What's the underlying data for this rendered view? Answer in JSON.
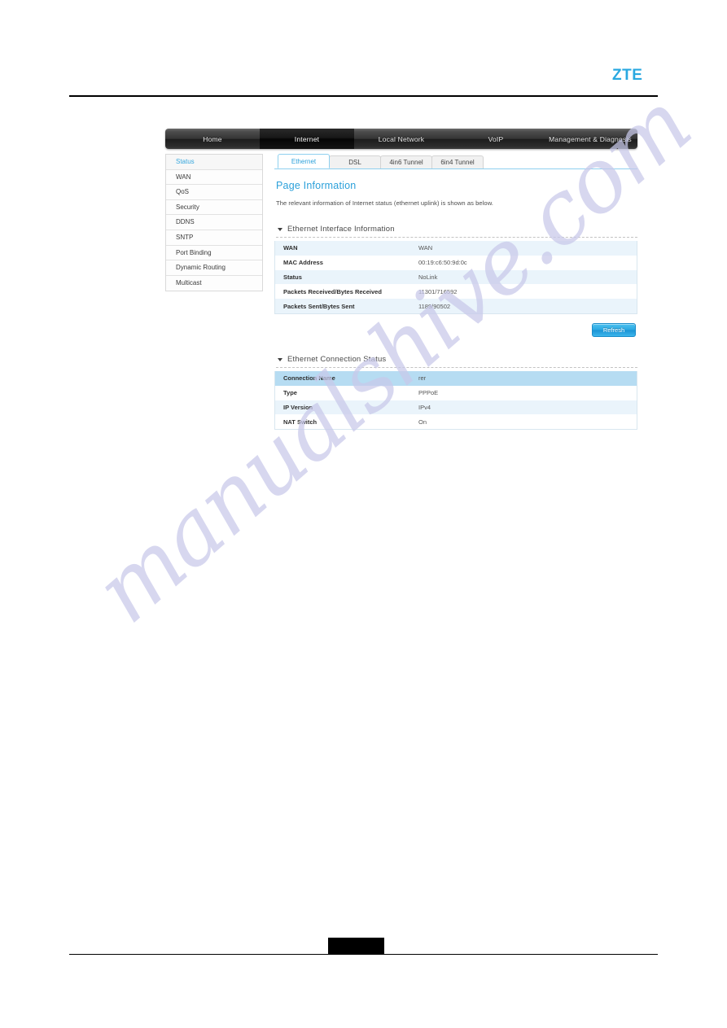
{
  "brand": {
    "logo_text": "ZTE"
  },
  "nav": {
    "items": [
      {
        "label": "Home",
        "active": false
      },
      {
        "label": "Internet",
        "active": true
      },
      {
        "label": "Local Network",
        "active": false
      },
      {
        "label": "VoIP",
        "active": false
      },
      {
        "label": "Management & Diagnosis",
        "active": false
      }
    ]
  },
  "sidebar": {
    "items": [
      {
        "label": "Status",
        "active": true
      },
      {
        "label": "WAN",
        "active": false
      },
      {
        "label": "QoS",
        "active": false
      },
      {
        "label": "Security",
        "active": false
      },
      {
        "label": "DDNS",
        "active": false
      },
      {
        "label": "SNTP",
        "active": false
      },
      {
        "label": "Port Binding",
        "active": false
      },
      {
        "label": "Dynamic Routing",
        "active": false
      },
      {
        "label": "Multicast",
        "active": false
      }
    ]
  },
  "tabs": [
    {
      "label": "Ethernet",
      "active": true
    },
    {
      "label": "DSL",
      "active": false
    },
    {
      "label": "4in6 Tunnel",
      "active": false
    },
    {
      "label": "6in4 Tunnel",
      "active": false
    }
  ],
  "page": {
    "title": "Page Information",
    "description": "The relevant information of Internet status (ethernet uplink) is shown as below."
  },
  "section_interface": {
    "title": "Ethernet Interface Information",
    "rows": [
      {
        "key": "WAN",
        "value": "WAN"
      },
      {
        "key": "MAC Address",
        "value": "00:19:c6:50:9d:0c"
      },
      {
        "key": "Status",
        "value": "NoLink"
      },
      {
        "key": "Packets Received/Bytes Received",
        "value": "11301/716592"
      },
      {
        "key": "Packets Sent/Bytes Sent",
        "value": "1189/90502"
      }
    ]
  },
  "refresh_button": {
    "label": "Refresh"
  },
  "section_connection": {
    "title": "Ethernet Connection Status",
    "rows": [
      {
        "key": "Connection Name",
        "value": "rer"
      },
      {
        "key": "Type",
        "value": "PPPoE"
      },
      {
        "key": "IP Version",
        "value": "IPv4"
      },
      {
        "key": "NAT Switch",
        "value": "On"
      }
    ]
  },
  "watermark": {
    "text": "manualshive.com"
  },
  "colors": {
    "brand_blue": "#29a8e0",
    "accent_blue": "#2ba0da",
    "row_alt": "#eaf4fb",
    "row_hilite": "#b6dcf2",
    "nav_dark": "#1c1c1c"
  }
}
